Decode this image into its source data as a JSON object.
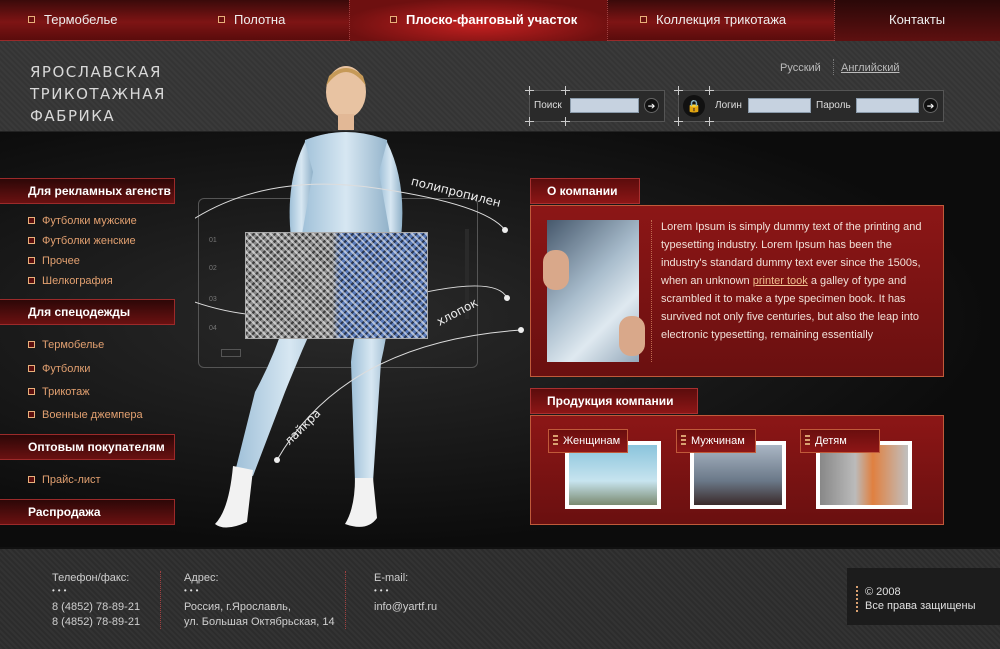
{
  "topnav": {
    "items": [
      {
        "label": "Термобелье"
      },
      {
        "label": "Полотна"
      },
      {
        "label": "Плоско-фанговый участок"
      },
      {
        "label": "Коллекция трикотажа"
      },
      {
        "label": "Контакты"
      }
    ]
  },
  "header": {
    "logo_lines": [
      "Ярославская",
      "трикотажная",
      "фабрика"
    ],
    "lang": {
      "ru": "Русский",
      "en": "Английский"
    },
    "search": {
      "label": "Поиск",
      "value": "",
      "go_icon": "arrow-right-icon"
    },
    "login": {
      "login_label": "Логин",
      "password_label": "Пароль",
      "login_value": "",
      "password_value": "",
      "lock_icon": "lock-icon",
      "go_icon": "arrow-right-icon"
    }
  },
  "sidebar": {
    "categories": [
      {
        "title": "Для рекламных агенств",
        "items": [
          "Футболки мужские",
          "Футболки женские",
          "Прочее",
          "Шелкография"
        ]
      },
      {
        "title": "Для спецодежды",
        "items": [
          "Термобелье",
          "Футболки",
          "Трикотаж",
          "Военные джемпера"
        ]
      },
      {
        "title": "Оптовым покупателям",
        "items": [
          "Прайс-лист"
        ]
      },
      {
        "title": "Распродажа",
        "items": []
      }
    ]
  },
  "hero": {
    "labels": {
      "polypropylene": "полипропилен",
      "cotton": "хлопок",
      "lycra": "лайкра"
    },
    "hud_ticks": [
      "01",
      "02",
      "03",
      "04"
    ]
  },
  "about": {
    "title": "О компании",
    "text_before": "Lorem Ipsum is simply dummy text of the printing and typesetting industry. Lorem Ipsum has been the industry's standard dummy text ever since the 1500s, when an unknown ",
    "link": "printer took",
    "text_after": " a galley of type and scrambled it to make a type specimen book. It has survived not only five centuries, but also the leap into electronic typesetting, remaining essentially"
  },
  "products": {
    "title": "Продукция компании",
    "tabs": [
      {
        "label": "Женщинам"
      },
      {
        "label": "Мужчинам"
      },
      {
        "label": "Детям"
      }
    ]
  },
  "footer": {
    "phone": {
      "label": "Телефон/факс:",
      "line1": "8 (4852) 78-89-21",
      "line2": "8 (4852) 78-89-21"
    },
    "address": {
      "label": "Адрес:",
      "line1": "Россия, г.Ярославль,",
      "line2": "ул. Большая Октябрьская, 14"
    },
    "email": {
      "label": "E-mail:",
      "value": "info@yartf.ru"
    },
    "copyright": {
      "year": "© 2008",
      "rights": "Все права защищены"
    }
  },
  "colors": {
    "accent": "#8c1616",
    "accent_border": "#c05a3a",
    "bullet": "#e8b07a",
    "link": "#e2a070"
  }
}
